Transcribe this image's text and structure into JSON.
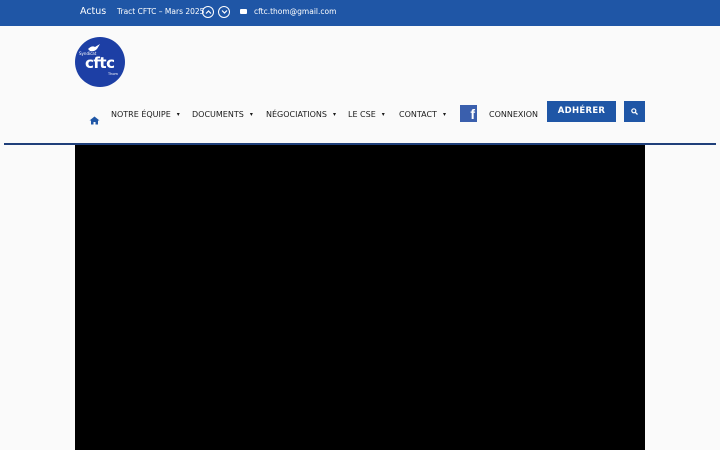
{
  "topbar": {
    "actus_label": "Actus",
    "ticker_text": "Tract CFTC – Mars 2025",
    "email": "cftc.thom@gmail.com",
    "background": "#1f56a6"
  },
  "logo": {
    "line1": "Syndicat",
    "brand": "cftc",
    "line3": "Thom"
  },
  "nav": {
    "items": [
      {
        "label": "NOTRE ÉQUIPE",
        "has_dropdown": true
      },
      {
        "label": "DOCUMENTS",
        "has_dropdown": true
      },
      {
        "label": "NÉGOCIATIONS",
        "has_dropdown": true
      },
      {
        "label": "LE CSE",
        "has_dropdown": true
      },
      {
        "label": "CONTACT",
        "has_dropdown": true
      }
    ],
    "facebook_glyph": "f",
    "login_label": "CONNEXION",
    "join_label": "ADHÉRER",
    "accent": "#1f56a6"
  },
  "caret": "▾"
}
